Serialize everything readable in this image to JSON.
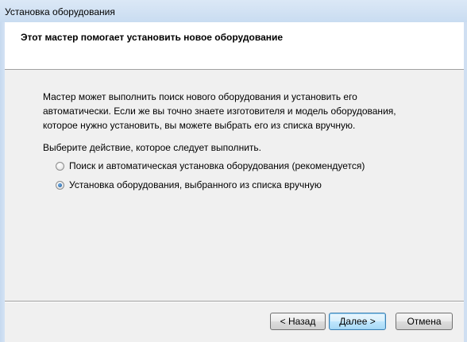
{
  "window": {
    "title": "Установка оборудования"
  },
  "header": {
    "title": "Этот мастер помогает установить новое оборудование"
  },
  "content": {
    "intro": "Мастер может выполнить поиск нового оборудования и установить его автоматически. Если же вы точно знаете изготовителя и модель оборудования, которое нужно установить, вы можете выбрать его из списка вручную.",
    "prompt": "Выберите действие, которое следует выполнить.",
    "options": [
      {
        "label": "Поиск и автоматическая установка оборудования (рекомендуется)",
        "selected": false
      },
      {
        "label": "Установка оборудования, выбранного из списка вручную",
        "selected": true
      }
    ]
  },
  "buttons": {
    "back": "< Назад",
    "next": "Далее >",
    "cancel": "Отмена"
  },
  "colors": {
    "background": "#f0f0f0",
    "header_background": "#ffffff",
    "default_button_border": "#3c7fb1"
  }
}
